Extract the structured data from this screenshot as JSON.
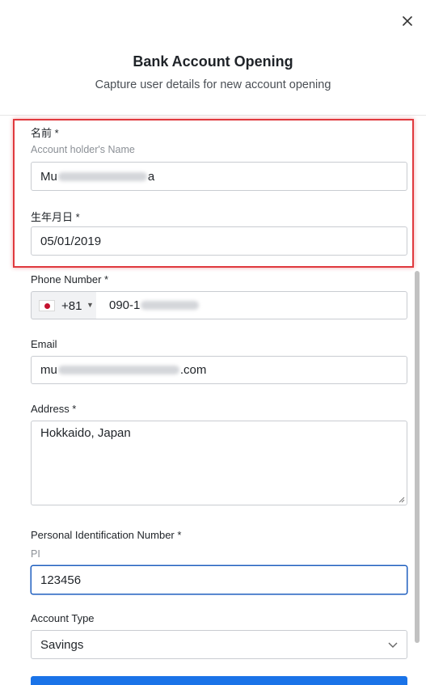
{
  "dialog": {
    "title": "Bank Account Opening",
    "subtitle": "Capture user details for new account opening",
    "close_icon": "close-icon"
  },
  "form": {
    "name": {
      "label": "名前 *",
      "helper": "Account holder's Name",
      "value_prefix": "Mu",
      "value_suffix": "a"
    },
    "dob": {
      "label": "生年月日 *",
      "value": "05/01/2019"
    },
    "phone": {
      "label": "Phone Number *",
      "country_flag": "japan-flag-icon",
      "dial_code": "+81",
      "value_prefix": "090-1"
    },
    "email": {
      "label": "Email",
      "value_prefix": "mu",
      "value_suffix": ".com"
    },
    "address": {
      "label": "Address *",
      "value": "Hokkaido, Japan"
    },
    "pin": {
      "label": "Personal Identification Number *",
      "helper": "PI",
      "value": "123456"
    },
    "account_type": {
      "label": "Account Type",
      "selected": "Savings"
    }
  },
  "colors": {
    "highlight": "#e0393e",
    "focus": "#1f5fbf",
    "primary": "#1a73e8"
  }
}
